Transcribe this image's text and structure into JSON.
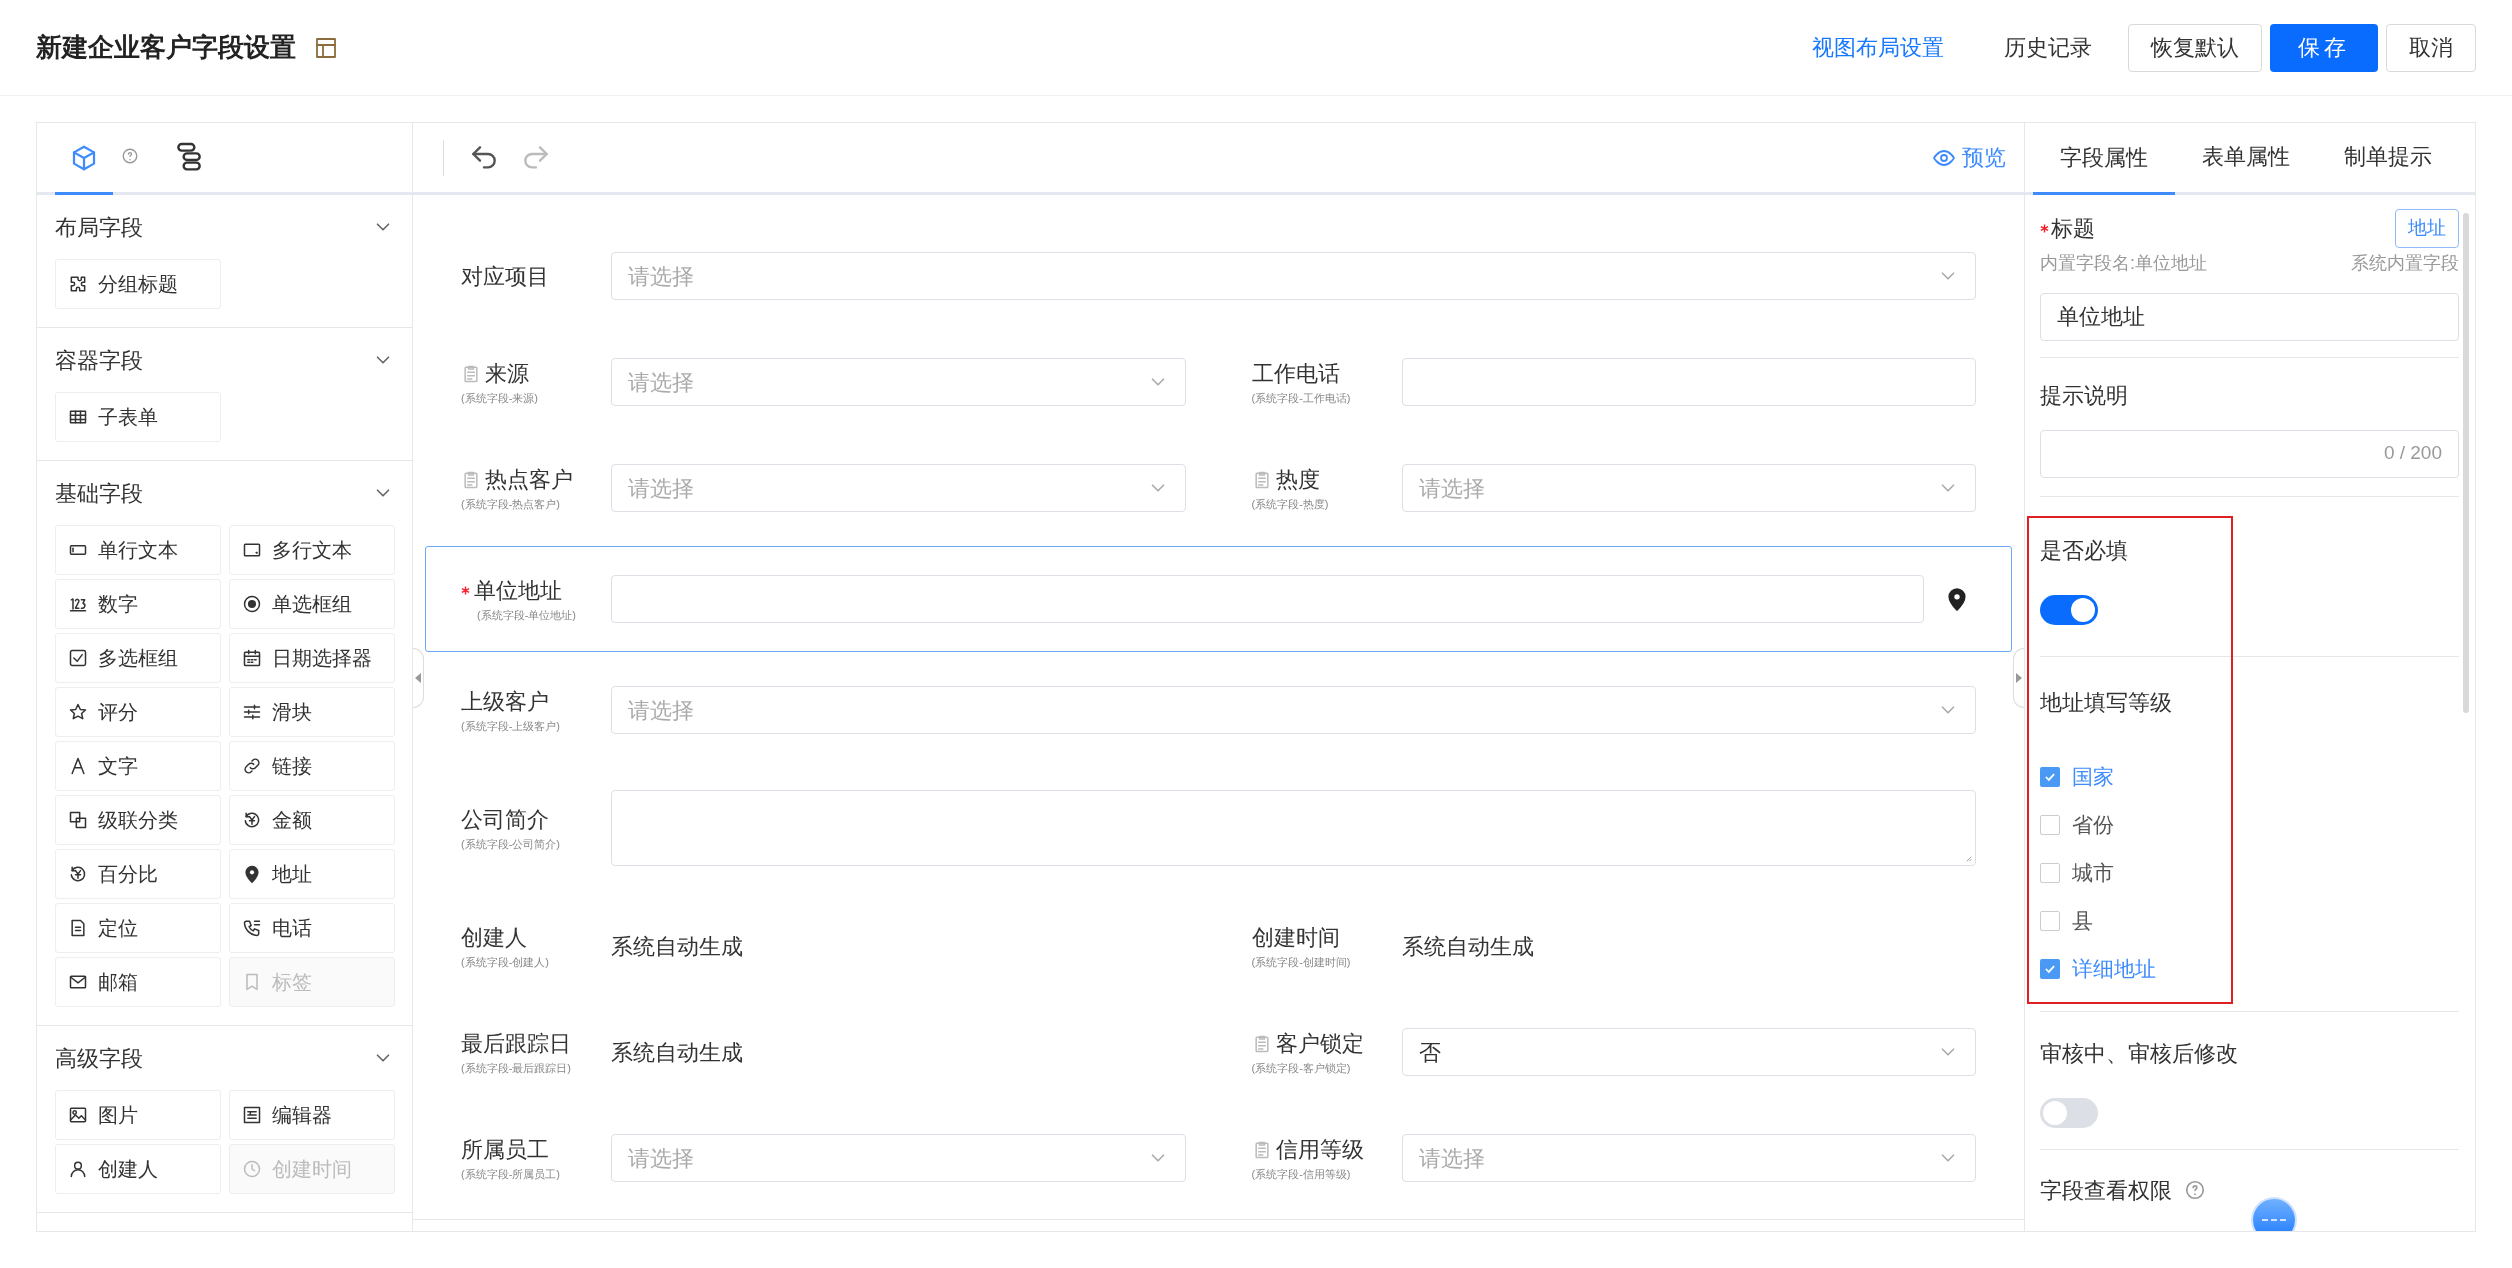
{
  "header": {
    "title": "新建企业客户字段设置",
    "actions": [
      {
        "label": "视图布局设置",
        "kind": "link"
      },
      {
        "label": "历史记录",
        "kind": "text"
      },
      {
        "label": "恢复默认",
        "kind": "outline"
      },
      {
        "label": "保存",
        "kind": "primary"
      },
      {
        "label": "取消",
        "kind": "outline"
      }
    ]
  },
  "palette": {
    "tabs": [
      {
        "selected": true
      },
      {
        "selected": false
      }
    ],
    "groups": [
      {
        "title": "布局字段",
        "expanded": true,
        "items": [
          {
            "label": "分组标题",
            "disabled": false
          }
        ]
      },
      {
        "title": "容器字段",
        "expanded": true,
        "items": [
          {
            "label": "子表单",
            "disabled": false
          }
        ]
      },
      {
        "title": "基础字段",
        "expanded": true,
        "items": [
          {
            "label": "单行文本",
            "disabled": false
          },
          {
            "label": "多行文本",
            "disabled": false
          },
          {
            "label": "数字",
            "disabled": false
          },
          {
            "label": "单选框组",
            "disabled": false
          },
          {
            "label": "多选框组",
            "disabled": false
          },
          {
            "label": "日期选择器",
            "disabled": false
          },
          {
            "label": "评分",
            "disabled": false
          },
          {
            "label": "滑块",
            "disabled": false
          },
          {
            "label": "文字",
            "disabled": false
          },
          {
            "label": "链接",
            "disabled": false
          },
          {
            "label": "级联分类",
            "disabled": false
          },
          {
            "label": "金额",
            "disabled": false
          },
          {
            "label": "百分比",
            "disabled": false
          },
          {
            "label": "地址",
            "disabled": false
          },
          {
            "label": "定位",
            "disabled": false
          },
          {
            "label": "电话",
            "disabled": false
          },
          {
            "label": "邮箱",
            "disabled": false
          },
          {
            "label": "标签",
            "disabled": true
          }
        ]
      },
      {
        "title": "高级字段",
        "expanded": true,
        "items": [
          {
            "label": "图片",
            "disabled": false
          },
          {
            "label": "编辑器",
            "disabled": false
          },
          {
            "label": "创建人",
            "disabled": false
          },
          {
            "label": "创建时间",
            "disabled": true
          }
        ]
      }
    ]
  },
  "canvas": {
    "toolbar": {
      "undo_disabled": false,
      "redo_disabled": true,
      "preview": "预览"
    },
    "rows": [
      {
        "selected": false,
        "fields": [
          {
            "label": "对应项目",
            "kind": "select",
            "placeholder": "请选择"
          }
        ]
      },
      {
        "selected": false,
        "fields": [
          {
            "label": "来源",
            "note": "(系统字段-来源)",
            "system_icon": true,
            "kind": "select",
            "placeholder": "请选择"
          },
          {
            "label": "工作电话",
            "note": "(系统字段-工作电话)",
            "kind": "input"
          }
        ]
      },
      {
        "selected": false,
        "fields": [
          {
            "label": "热点客户",
            "note": "(系统字段-热点客户)",
            "system_icon": true,
            "kind": "select",
            "placeholder": "请选择"
          },
          {
            "label": "热度",
            "note": "(系统字段-热度)",
            "system_icon": true,
            "kind": "select",
            "placeholder": "请选择"
          }
        ]
      },
      {
        "selected": true,
        "fields": [
          {
            "label": "单位地址",
            "note": "(系统字段-单位地址)",
            "required": true,
            "kind": "address"
          }
        ]
      },
      {
        "selected": false,
        "fields": [
          {
            "label": "上级客户",
            "note": "(系统字段-上级客户)",
            "kind": "select",
            "placeholder": "请选择"
          }
        ]
      },
      {
        "selected": false,
        "fields": [
          {
            "label": "公司简介",
            "note": "(系统字段-公司简介)",
            "kind": "textarea"
          }
        ]
      },
      {
        "selected": false,
        "fields": [
          {
            "label": "创建人",
            "note": "(系统字段-创建人)",
            "kind": "static",
            "value": "系统自动生成"
          },
          {
            "label": "创建时间",
            "note": "(系统字段-创建时间)",
            "kind": "static",
            "value": "系统自动生成"
          }
        ]
      },
      {
        "selected": false,
        "fields": [
          {
            "label": "最后跟踪日",
            "note": "(系统字段-最后跟踪日)",
            "kind": "static",
            "value": "系统自动生成"
          },
          {
            "label": "客户锁定",
            "note": "(系统字段-客户锁定)",
            "system_icon": true,
            "kind": "select",
            "value": "否"
          }
        ]
      },
      {
        "selected": false,
        "fields": [
          {
            "label": "所属员工",
            "note": "(系统字段-所属员工)",
            "kind": "select",
            "placeholder": "请选择"
          },
          {
            "label": "信用等级",
            "note": "(系统字段-信用等级)",
            "system_icon": true,
            "kind": "select",
            "placeholder": "请选择"
          }
        ]
      }
    ]
  },
  "properties": {
    "tabs": [
      {
        "label": "字段属性",
        "selected": true
      },
      {
        "label": "表单属性",
        "selected": false
      },
      {
        "label": "制单提示",
        "selected": false
      }
    ],
    "title_field": {
      "label": "标题",
      "required": true,
      "badge": "地址",
      "builtin_name": "内置字段名:单位地址",
      "source": "系统内置字段",
      "value": "单位地址"
    },
    "hint": {
      "label": "提示说明",
      "counter": "0 / 200"
    },
    "required": {
      "label": "是否必填",
      "on": true
    },
    "address_levels": {
      "label": "地址填写等级",
      "options": [
        {
          "label": "国家",
          "checked": true
        },
        {
          "label": "省份",
          "checked": false
        },
        {
          "label": "城市",
          "checked": false
        },
        {
          "label": "县",
          "checked": false
        },
        {
          "label": "详细地址",
          "checked": true
        }
      ]
    },
    "edit_in_review": {
      "label": "审核中、审核后修改",
      "on": false
    },
    "view_permission": {
      "label": "字段查看权限"
    }
  }
}
